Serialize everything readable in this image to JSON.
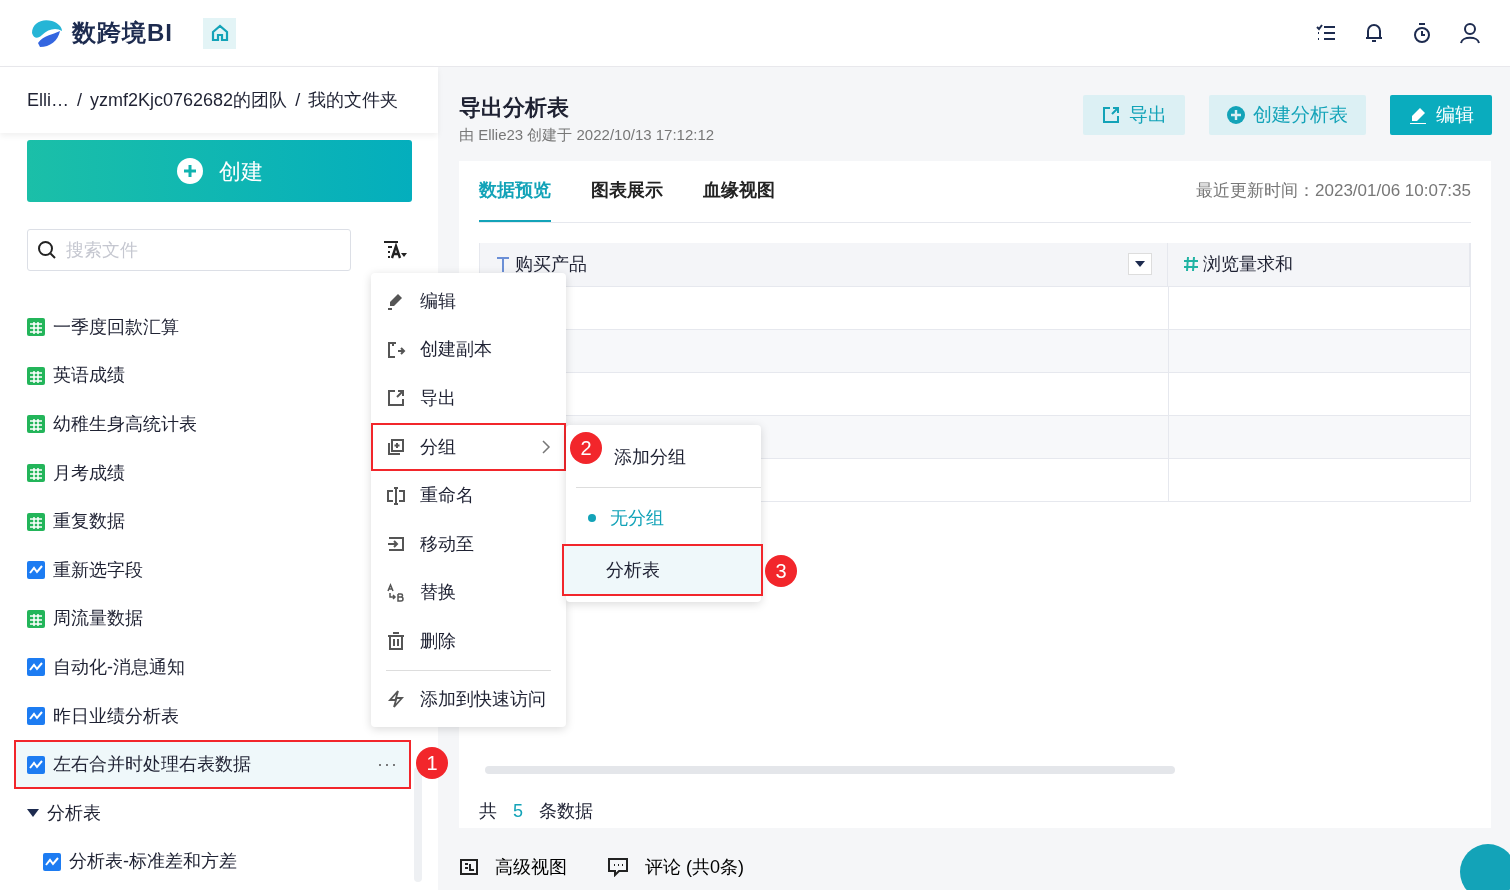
{
  "header": {
    "logo_text": "数跨境BI"
  },
  "breadcrumb": [
    {
      "label": "Elli…",
      "kind": "link"
    },
    {
      "label": "/",
      "kind": "separator"
    },
    {
      "label": "yzmf2Kjc0762682的团队",
      "kind": "link"
    },
    {
      "label": "/",
      "kind": "separator"
    },
    {
      "label": "我的文件夹",
      "kind": "current"
    }
  ],
  "sidebar": {
    "create_button": "创建",
    "search": {
      "placeholder": "搜索文件"
    },
    "items": [
      {
        "label": "一季度回款汇算",
        "kind": "table",
        "selected": false
      },
      {
        "label": "英语成绩",
        "kind": "table",
        "selected": false
      },
      {
        "label": "幼稚生身高统计表",
        "kind": "table",
        "selected": false
      },
      {
        "label": "月考成绩",
        "kind": "table",
        "selected": false
      },
      {
        "label": "重复数据",
        "kind": "table",
        "selected": false
      },
      {
        "label": "重新选字段",
        "kind": "chart",
        "selected": false
      },
      {
        "label": "周流量数据",
        "kind": "table",
        "selected": false
      },
      {
        "label": "自动化-消息通知",
        "kind": "chart",
        "selected": false
      },
      {
        "label": "昨日业绩分析表",
        "kind": "chart",
        "selected": false
      },
      {
        "label": "左右合并时处理右表数据",
        "kind": "chart",
        "selected": true,
        "more": "···"
      },
      {
        "label": "分析表",
        "kind": "group",
        "expanded": true,
        "selected": false,
        "children": [
          {
            "label": "分析表-标准差和方差",
            "kind": "chart",
            "selected": false
          }
        ]
      }
    ]
  },
  "context_menu": {
    "items": [
      {
        "label": "编辑",
        "selected": false
      },
      {
        "label": "创建副本",
        "selected": false
      },
      {
        "label": "导出",
        "selected": false
      },
      {
        "label": "分组",
        "selected": true,
        "submenu": true
      },
      {
        "label": "重命名",
        "selected": false
      },
      {
        "label": "移动至",
        "selected": false
      },
      {
        "label": "替换",
        "selected": false
      },
      {
        "label": "删除",
        "selected": false
      },
      {
        "label": "添加到快速访问",
        "selected": false,
        "divider_before": true
      }
    ]
  },
  "submenu": {
    "add_label": "添加分组",
    "items": [
      {
        "label": "无分组",
        "selected": true,
        "highlighted": false
      },
      {
        "label": "分析表",
        "selected": false,
        "highlighted": true
      }
    ]
  },
  "annotations": [
    {
      "number": "1"
    },
    {
      "number": "2"
    },
    {
      "number": "3"
    }
  ],
  "main": {
    "title": "导出分析表",
    "subtitle": "由 Ellie23 创建于 2022/10/13 17:12:12",
    "buttons": [
      {
        "label": "导出",
        "kind": "export",
        "primary": false
      },
      {
        "label": "创建分析表",
        "kind": "create",
        "primary": false
      },
      {
        "label": "编辑",
        "kind": "edit",
        "primary": true
      }
    ],
    "tabs": [
      {
        "label": "数据预览",
        "selected": true
      },
      {
        "label": "图表展示",
        "selected": false
      },
      {
        "label": "血缘视图",
        "selected": false
      }
    ],
    "update_time": "最近更新时间：2023/01/06 10:07:35",
    "table": {
      "columns": [
        {
          "label": "购买产品",
          "kind": "text",
          "sortable": true
        },
        {
          "label": "浏览量求和",
          "kind": "number",
          "sortable": false
        }
      ]
    },
    "footer": {
      "prefix": "共",
      "count": "5",
      "suffix": "条数据"
    },
    "bottom_bar": [
      {
        "label": "高级视图",
        "kind": "view"
      },
      {
        "label": "评论 (共0条)",
        "kind": "comment"
      }
    ]
  }
}
